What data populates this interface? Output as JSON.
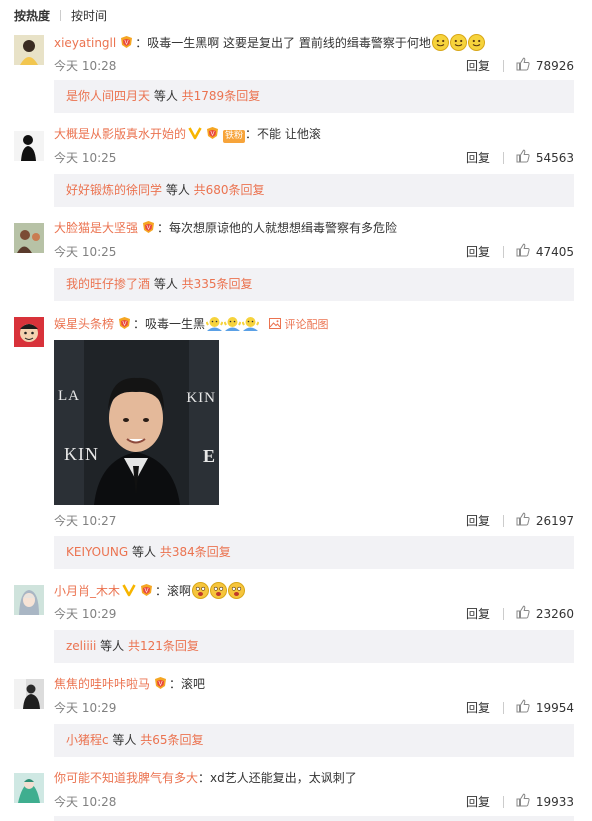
{
  "sort": {
    "hot": "按热度",
    "time": "按时间"
  },
  "colors": {
    "accent": "#eb7350",
    "sub_bg": "#f2f2f5"
  },
  "comments": [
    {
      "user": "xieyatingll",
      "text": "吸毒一生黑啊 这要是复出了 置前线的缉毒警察于何地",
      "time": "今天 10:28",
      "reply": "回复",
      "likes": "78926",
      "sub": {
        "names": "是你人间四月天",
        "mid": " 等人 ",
        "count": "共1789条回复"
      }
    },
    {
      "user": "大概是从影版真水开始的",
      "fan_badge": "铁粉",
      "text": "不能 让他滚",
      "time": "今天 10:25",
      "reply": "回复",
      "likes": "54563",
      "sub": {
        "names": "好好锻炼的徐同学",
        "mid": " 等人 ",
        "count": "共680条回复"
      }
    },
    {
      "user": "大脸猫是大坚强",
      "text": "每次想原谅他的人就想想缉毒警察有多危险",
      "time": "今天 10:25",
      "reply": "回复",
      "likes": "47405",
      "sub": {
        "names": "我的旺仔掺了酒",
        "mid": " 等人 ",
        "count": "共335条回复"
      }
    },
    {
      "user": "娱星头条榜",
      "text": "吸毒一生黑",
      "config": "评论配图",
      "photo_text": [
        "LA",
        "KIN",
        "E"
      ],
      "time": "今天 10:27",
      "reply": "回复",
      "likes": "26197",
      "sub": {
        "names": "KEIYOUNG",
        "mid": " 等人 ",
        "count": "共384条回复"
      }
    },
    {
      "user": "小月肖_木木",
      "text": "滚啊",
      "time": "今天 10:29",
      "reply": "回复",
      "likes": "23260",
      "sub": {
        "names": "zeliiii",
        "mid": " 等人 ",
        "count": "共121条回复"
      }
    },
    {
      "user": "焦焦的哇咔咔啦马",
      "text": "滚吧",
      "time": "今天 10:29",
      "reply": "回复",
      "likes": "19954",
      "sub": {
        "names": "小猪程c",
        "mid": " 等人 ",
        "count": "共65条回复"
      }
    },
    {
      "user": "你可能不知道我脾气有多大",
      "text": "xd艺人还能复出，太讽刺了",
      "time": "今天 10:28",
      "reply": "回复",
      "likes": "19933"
    }
  ]
}
